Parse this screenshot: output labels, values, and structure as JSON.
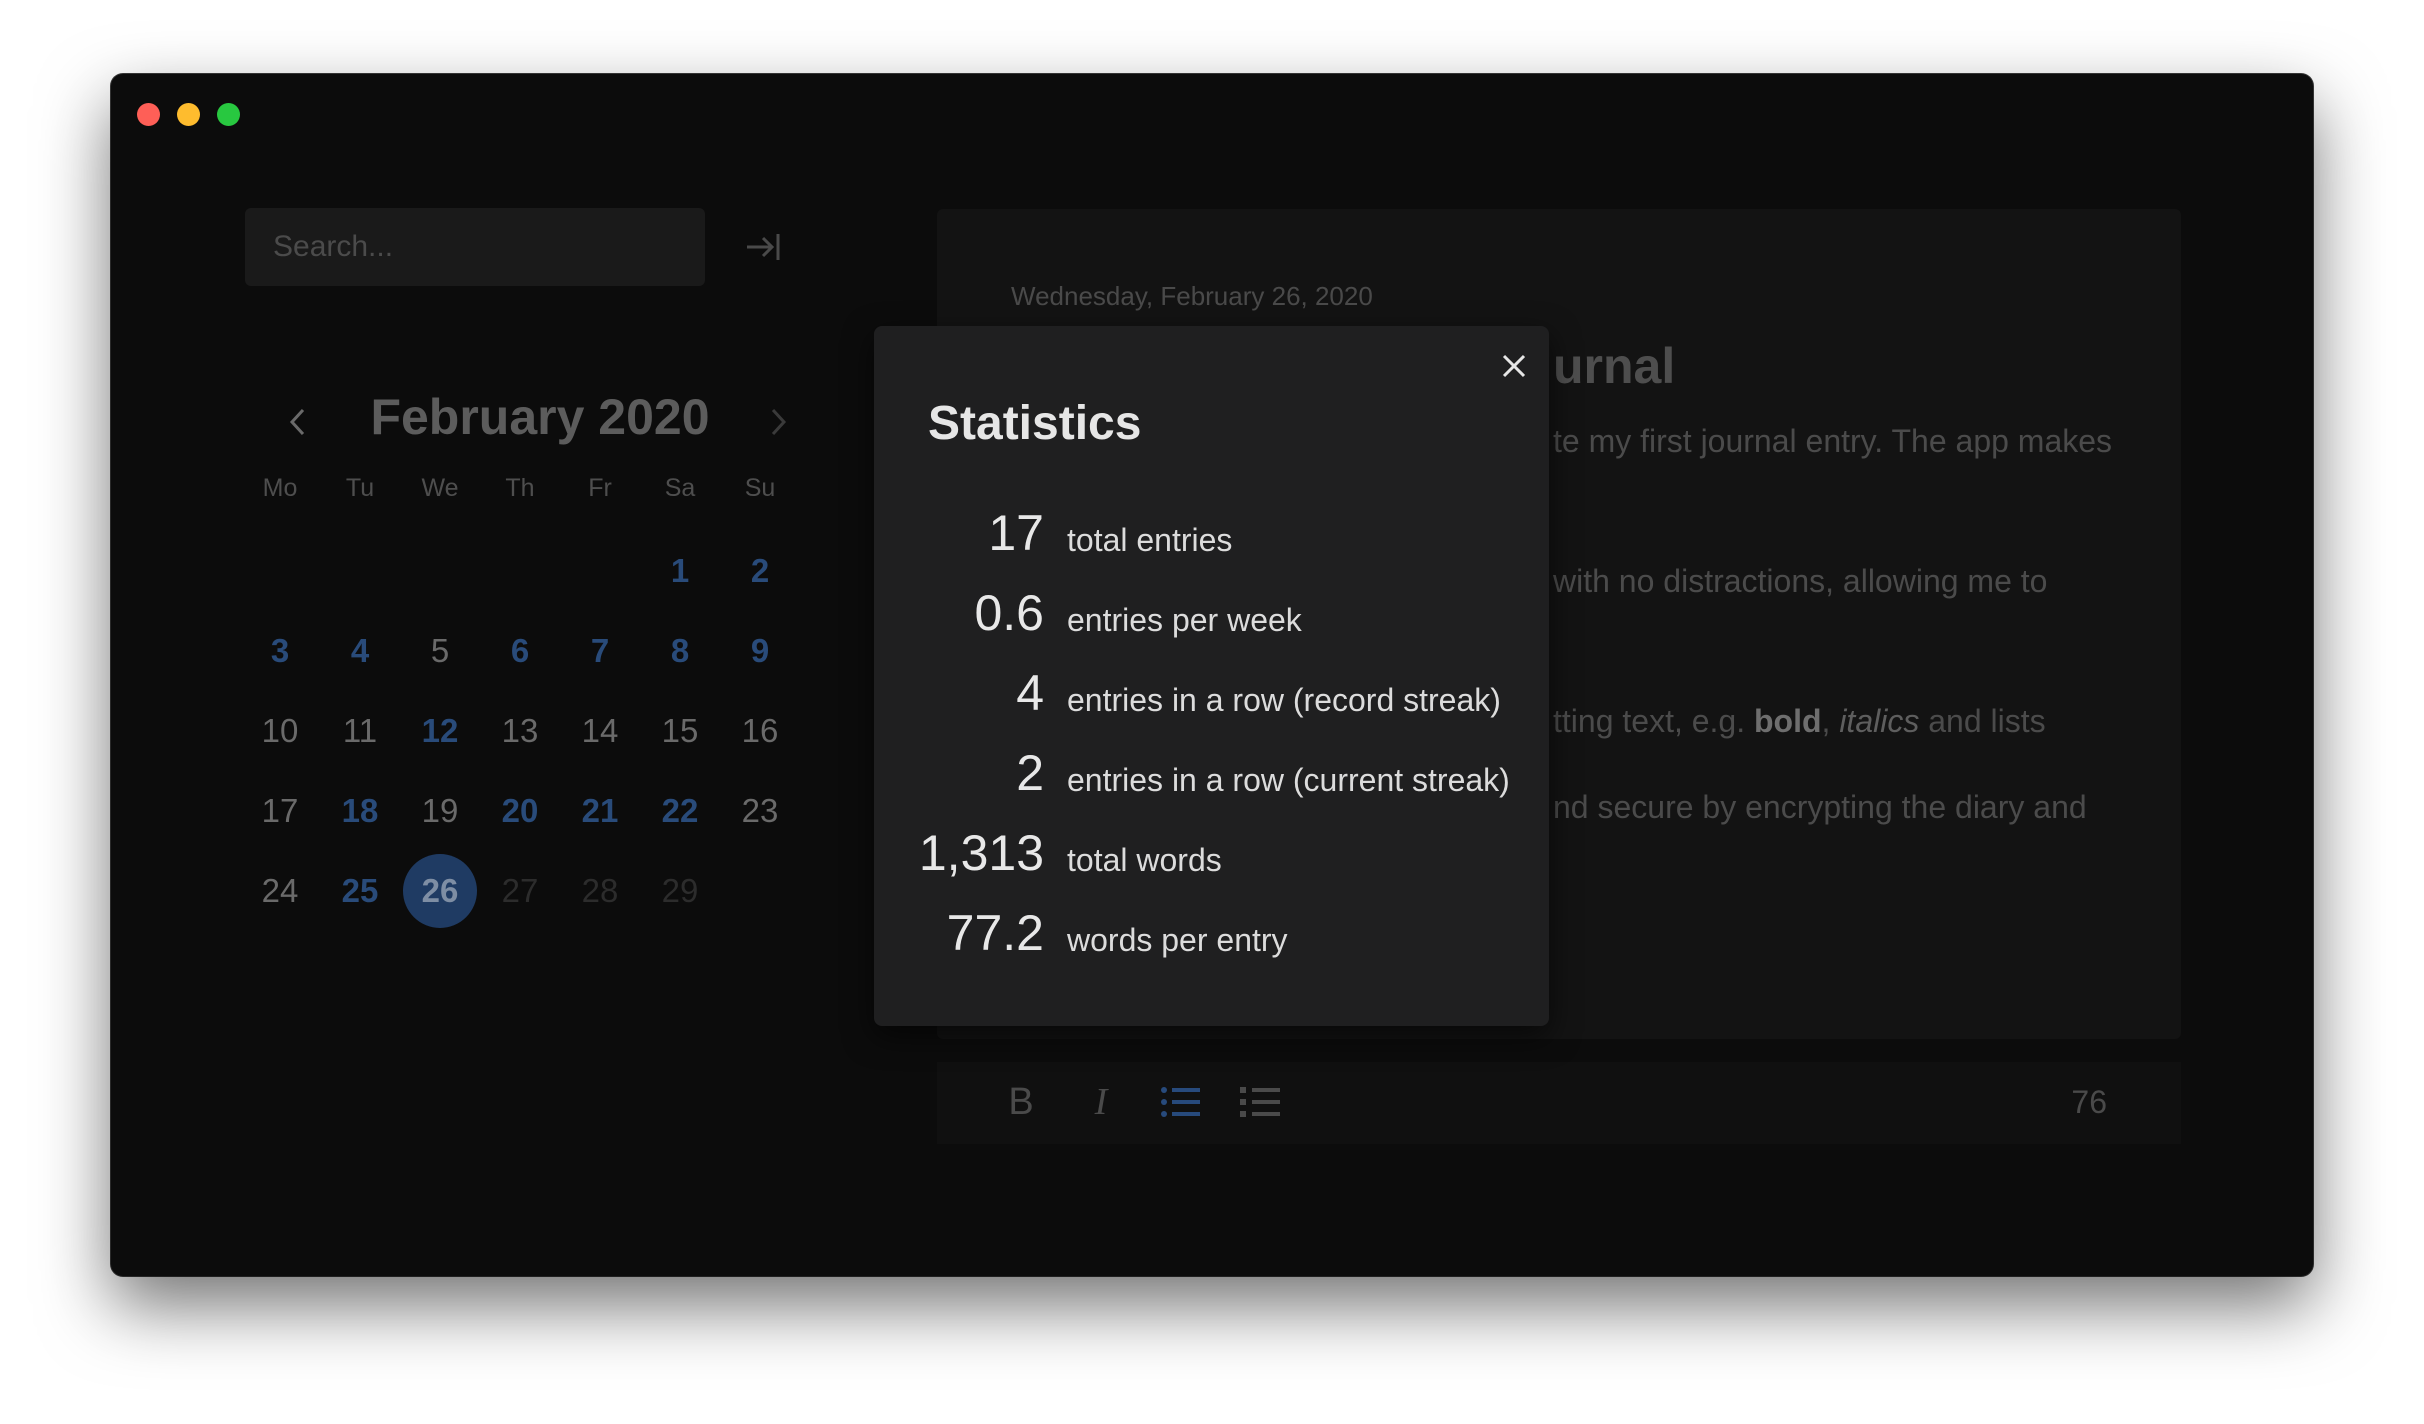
{
  "search": {
    "placeholder": "Search..."
  },
  "calendar": {
    "title": "February 2020",
    "weekdays": [
      "Mo",
      "Tu",
      "We",
      "Th",
      "Fr",
      "Sa",
      "Su"
    ],
    "days": [
      {
        "label": "1",
        "state": "entry"
      },
      {
        "label": "2",
        "state": "entry"
      },
      {
        "label": "3",
        "state": "entry"
      },
      {
        "label": "4",
        "state": "entry"
      },
      {
        "label": "5",
        "state": "normal"
      },
      {
        "label": "6",
        "state": "entry"
      },
      {
        "label": "7",
        "state": "entry"
      },
      {
        "label": "8",
        "state": "entry"
      },
      {
        "label": "9",
        "state": "entry"
      },
      {
        "label": "10",
        "state": "normal"
      },
      {
        "label": "11",
        "state": "normal"
      },
      {
        "label": "12",
        "state": "entry"
      },
      {
        "label": "13",
        "state": "normal"
      },
      {
        "label": "14",
        "state": "normal"
      },
      {
        "label": "15",
        "state": "normal"
      },
      {
        "label": "16",
        "state": "normal"
      },
      {
        "label": "17",
        "state": "normal"
      },
      {
        "label": "18",
        "state": "entry"
      },
      {
        "label": "19",
        "state": "normal"
      },
      {
        "label": "20",
        "state": "entry"
      },
      {
        "label": "21",
        "state": "entry"
      },
      {
        "label": "22",
        "state": "entry"
      },
      {
        "label": "23",
        "state": "normal"
      },
      {
        "label": "24",
        "state": "normal"
      },
      {
        "label": "25",
        "state": "entry"
      },
      {
        "label": "26",
        "state": "selected"
      },
      {
        "label": "27",
        "state": "future"
      },
      {
        "label": "28",
        "state": "future"
      },
      {
        "label": "29",
        "state": "future"
      }
    ]
  },
  "editor": {
    "date": "Wednesday, February 26, 2020",
    "title_visible": "urnal",
    "line1": "te my first journal entry. The app makes",
    "line2": "with no distractions, allowing me to",
    "line3_pre": "tting text, e.g. ",
    "line3_bold": "bold",
    "line3_sep": ", ",
    "line3_italic": "italics",
    "line3_post": " and lists",
    "line4": "nd secure by encrypting the diary and",
    "word_count": "76"
  },
  "toolbar": {
    "bold_icon": "B",
    "italic_icon": "I"
  },
  "statistics": {
    "title": "Statistics",
    "items": [
      {
        "value": "17",
        "label": "total entries"
      },
      {
        "value": "0.6",
        "label": "entries per week"
      },
      {
        "value": "4",
        "label": "entries in a row (record streak)"
      },
      {
        "value": "2",
        "label": "entries in a row (current streak)"
      },
      {
        "value": "1,313",
        "label": "total words"
      },
      {
        "value": "77.2",
        "label": "words per entry"
      }
    ]
  },
  "colors": {
    "accent": "#274a7c",
    "background": "#0c0c0c",
    "dialog": "#1f1f20"
  }
}
